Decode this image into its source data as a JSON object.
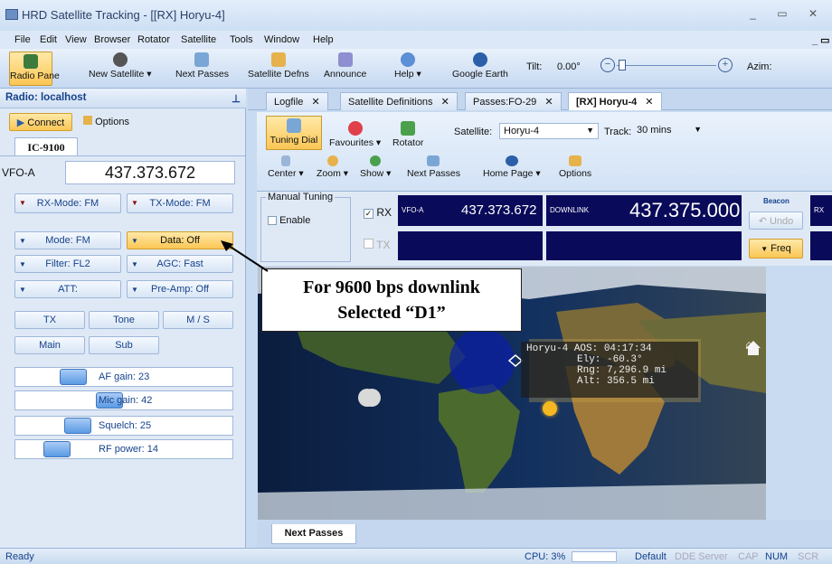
{
  "window": {
    "title": "HRD Satellite Tracking - [[RX]  Horyu-4]",
    "controls": "_ ▭ ✕"
  },
  "menu": [
    "File",
    "Edit",
    "View",
    "Browser",
    "Rotator",
    "Satellite",
    "Tools",
    "Window",
    "Help"
  ],
  "toolbar": {
    "radio_pane": "Radio Pane",
    "new_satellite": "New Satellite ▾",
    "next_passes": "Next Passes",
    "satellite_defns": "Satellite Defns",
    "announce": "Announce",
    "help": "Help ▾",
    "google_earth": "Google Earth",
    "tilt_label": "Tilt:",
    "tilt_value": "0.00°",
    "azim_label": "Azim:"
  },
  "left_pane": {
    "header": "Radio: localhost",
    "connect": "Connect",
    "options": "Options",
    "radio_tab": "IC-9100",
    "vfo_label": "VFO-A",
    "vfo_value": "437.373.672",
    "rx_mode": "RX-Mode: FM",
    "tx_mode": "TX-Mode: FM",
    "mode": "Mode: FM",
    "data": "Data: Off",
    "filter": "Filter: FL2",
    "agc": "AGC: Fast",
    "att": "ATT:",
    "preamp": "Pre-Amp: Off",
    "tx": "TX",
    "tone": "Tone",
    "ms": "M / S",
    "main": "Main",
    "sub": "Sub",
    "af_gain": "AF gain: 23",
    "mic_gain": "Mic gain: 42",
    "squelch": "Squelch: 25",
    "rf_power": "RF power: 14",
    "af_gain_level": 23,
    "mic_gain_level": 42,
    "squelch_level": 25,
    "rf_power_level": 14
  },
  "doc_tabs": [
    "Logfile",
    "Satellite Definitions",
    "Passes:FO-29",
    "[RX]  Horyu-4"
  ],
  "inner_toolbar": {
    "tuning_dial": "Tuning Dial",
    "favourites": "Favourites ▾",
    "rotator": "Rotator",
    "satellite_label": "Satellite:",
    "satellite_value": "Horyu-4",
    "track_label": "Track:",
    "track_value": "30 mins",
    "center": "Center ▾",
    "zoom": "Zoom ▾",
    "show": "Show ▾",
    "next_passes": "Next Passes",
    "home_page": "Home Page ▾",
    "options": "Options"
  },
  "tuning": {
    "manual_tuning": "Manual Tuning",
    "enable": "Enable",
    "rx": "RX",
    "tx": "TX",
    "vfo_a_label": "VFO-A",
    "vfo_a_value": "437.373.672",
    "downlink_label": "DOWNLINK",
    "downlink_value": "437.375.000",
    "beacon": "Beacon",
    "undo": "Undo",
    "freq": "Freq",
    "rx_short": "RX"
  },
  "annotation": {
    "line1": "For 9600 bps downlink",
    "line2": "Selected “D1”"
  },
  "sat_info": {
    "name": "Horyu-4",
    "aos": "AOS: 04:17:34",
    "ely": "Ely: -60.3°",
    "rng": "Rng: 7,296.9 mi",
    "alt": "Alt: 356.5 mi"
  },
  "bottom_tab": "Next Passes",
  "status": {
    "ready": "Ready",
    "cpu": "CPU: 3%",
    "default": "Default",
    "dde": "DDE Server",
    "cap": "CAP",
    "num": "NUM",
    "scr": "SCR"
  },
  "colors": {
    "accent": "#fbc654",
    "lcd": "#0a0a5a",
    "panel": "#dfe9f6"
  }
}
